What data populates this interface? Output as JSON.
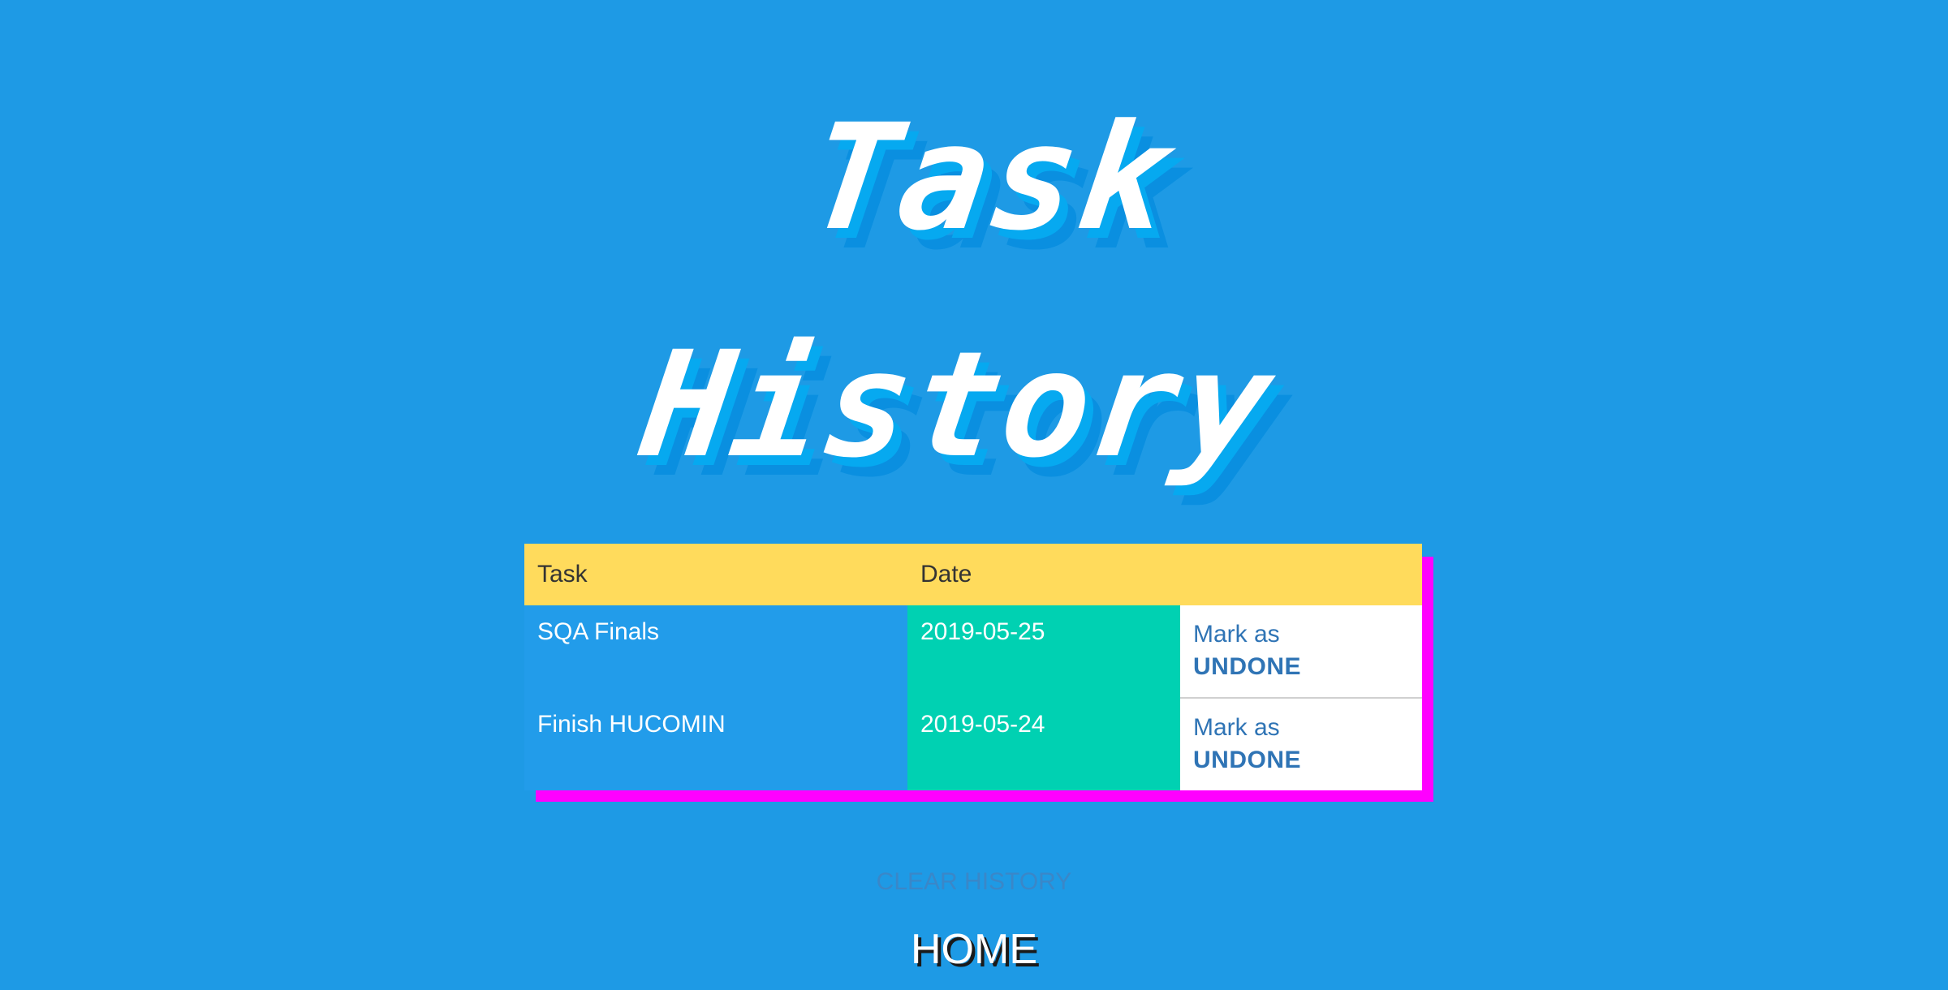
{
  "title": {
    "line1": "Task",
    "line2": "History"
  },
  "table": {
    "headers": [
      "Task",
      "Date",
      ""
    ],
    "rows": [
      {
        "task": "SQA Finals",
        "date": "2019-05-25",
        "action_line1": "Mark as",
        "action_line2": "UNDONE"
      },
      {
        "task": "Finish HUCOMIN",
        "date": "2019-05-24",
        "action_line1": "Mark as",
        "action_line2": "UNDONE"
      }
    ]
  },
  "buttons": {
    "clear_history": "CLEAR HISTORY",
    "home": "HOME"
  },
  "colors": {
    "background": "#1e9ae5",
    "header": "#ffdb5c",
    "task_cell": "#229cea",
    "date_cell": "#00d1b2",
    "table_shadow": "#ff00ff",
    "action_text": "#2f74b5"
  }
}
